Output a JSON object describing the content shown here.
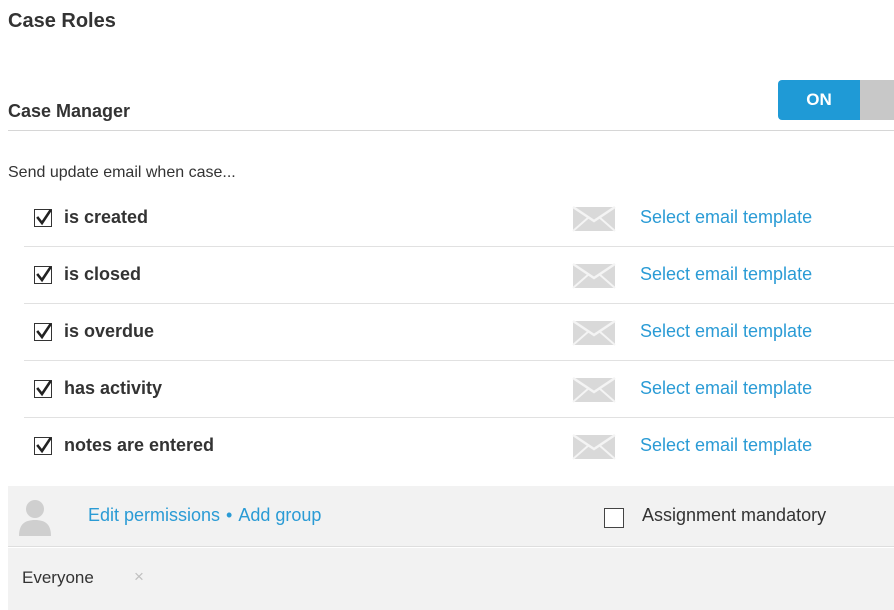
{
  "section": {
    "title": "Case Roles"
  },
  "role": {
    "name": "Case Manager",
    "toggle_label": "ON",
    "toggle_color": "#1f9ad6"
  },
  "notify": {
    "intro": "Send update email when case...",
    "events": [
      {
        "label": "is created",
        "checked": true,
        "template_link": "Select email template",
        "icon": "envelope-icon"
      },
      {
        "label": "is closed",
        "checked": true,
        "template_link": "Select email template",
        "icon": "envelope-icon"
      },
      {
        "label": "is overdue",
        "checked": true,
        "template_link": "Select email template",
        "icon": "envelope-icon"
      },
      {
        "label": "has activity",
        "checked": true,
        "template_link": "Select email template",
        "icon": "envelope-icon"
      },
      {
        "label": "notes are entered",
        "checked": true,
        "template_link": "Select email template",
        "icon": "envelope-icon"
      }
    ]
  },
  "permissions": {
    "icon": "user-avatar-icon",
    "edit_label": "Edit permissions",
    "separator": "•",
    "add_group_label": "Add group",
    "assignment_label": "Assignment mandatory",
    "assignment_checked": false
  },
  "groups": [
    {
      "name": "Everyone",
      "remove_glyph": "×"
    }
  ],
  "colors": {
    "link": "#2a9bd5",
    "panel_bg": "#f2f2f2",
    "toggle_off": "#c8c8c8"
  }
}
